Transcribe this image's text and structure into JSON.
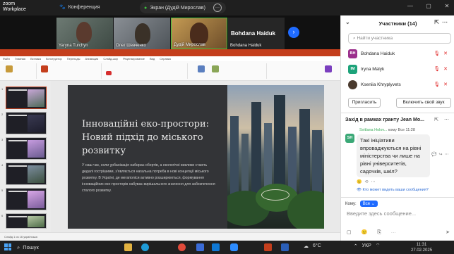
{
  "titlebar": {
    "app_line1": "zoom",
    "app_line2": "Workplace",
    "conference_label": "Конференция",
    "screen_label": "Экран (Дудій Мирослав)",
    "more_label": "···",
    "window_controls": [
      "—",
      "▢",
      "✕"
    ]
  },
  "videos": [
    {
      "name": "Yaryna Turchyn"
    },
    {
      "name": "Олег Шевченко"
    },
    {
      "name": "Дудій Мирослав"
    },
    {
      "name": "Bohdana Haiduk",
      "big_name": "Bohdana Haiduk"
    }
  ],
  "ppt": {
    "menu": [
      "Файл",
      "Главная",
      "Вставка",
      "Конструктор",
      "Переходы",
      "Анимация",
      "Слайд-шоу",
      "Рецензирование",
      "Вид",
      "Справка"
    ],
    "slide_numbers": [
      "1",
      "2",
      "3",
      "4",
      "5",
      "6"
    ],
    "status": "Слайд 1 из 16    українська"
  },
  "slide": {
    "title": "Інноваційні еко-простори: Новий підхід до міського розвитку",
    "body": "У наш час, коли урбанізація набирає обертів, а екологічні виклики стають дедалі гострішими, з'являється нагальна потреба в нові концепції міського розвитку. В Україні, де мегаполіси активно розширюються, формування інноваційних еко-просторів набуває вирішального значення для забезпечення сталого розвитку."
  },
  "panel": {
    "title": "Участники (14)",
    "search_placeholder": "Найти участника",
    "participants": [
      {
        "initials": "BH",
        "name": "Bohdana Haiduk",
        "color": "#9b2f8c"
      },
      {
        "initials": "IM",
        "name": "Iryna Malyk",
        "color": "#1da37a"
      },
      {
        "initials": "",
        "name": "Kseniia Khryplyvets",
        "color": "#4a3a2e"
      }
    ],
    "invite_button": "Пригласить",
    "unmute_button": "Включить свой звук",
    "chat_title": "Захід в рамках гранту Jean Mo...",
    "msg_sender": "Svitlana Holov...",
    "msg_to": "кому Все",
    "msg_time": "11:28",
    "msg_initials": "SH",
    "msg_text": "Такі ініціативи впроваджуються на рівні міністерства чи лише на рівні університетів, садочків, шкіл?",
    "who_can_see": "Кто может видеть ваши сообщения?",
    "to_label": "Кому:",
    "to_value": "Все",
    "compose_placeholder": "Введите здесь сообщение..."
  },
  "taskbar": {
    "search_label": "Пошук",
    "weather": "6°C",
    "lang": "УКР",
    "time": "11:31",
    "date": "27.02.2025"
  },
  "colors": {
    "zoom_blue": "#1f6bff",
    "ppt_red": "#c43e1c",
    "mute_red": "#e02828",
    "active_speaker": "#3ec13e"
  }
}
